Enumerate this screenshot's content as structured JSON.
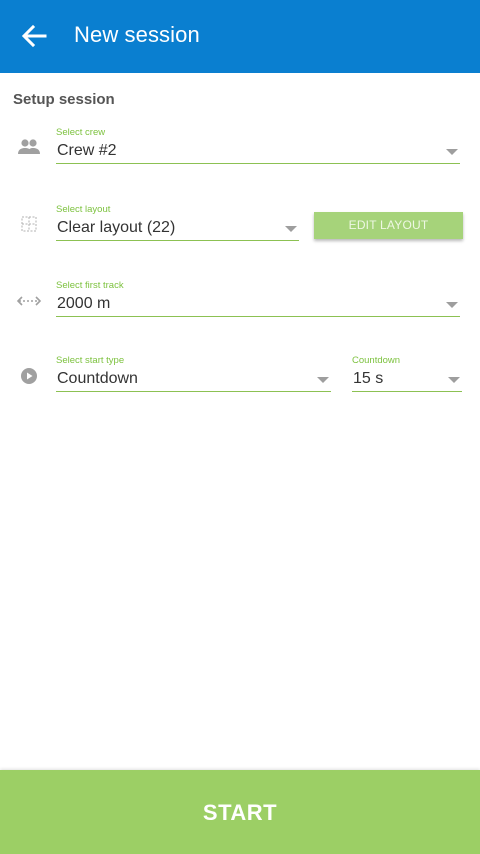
{
  "appbar": {
    "title": "New session",
    "back_icon": "arrow-left-icon",
    "color": "#0a7fd0"
  },
  "setup": {
    "title": "Setup session"
  },
  "crew": {
    "label": "Select crew",
    "value": "Crew #2",
    "icon": "group-icon"
  },
  "layout": {
    "label": "Select layout",
    "value": "Clear layout (22)",
    "icon": "layout-grid-icon",
    "edit_label": "EDIT LAYOUT"
  },
  "track": {
    "label": "Select first track",
    "value": "2000 m",
    "icon": "distance-arrows-icon"
  },
  "start_type": {
    "label": "Select start type",
    "value": "Countdown",
    "icon": "play-circle-icon"
  },
  "countdown": {
    "label": "Countdown",
    "value": "15 s"
  },
  "start_button": {
    "label": "START",
    "color": "#9ccf65"
  },
  "accent_color": "#8cc152"
}
